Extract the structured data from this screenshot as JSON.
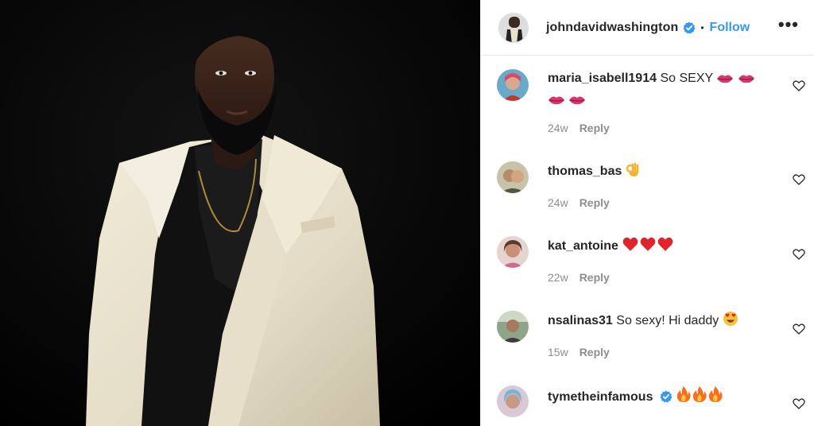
{
  "header": {
    "username": "johndavidwashington",
    "separator": "•",
    "follow_label": "Follow",
    "more_label": "•••"
  },
  "comments": [
    {
      "username": "maria_isabell1914",
      "text": "So SEXY",
      "emoji": [
        "lips",
        "lips",
        "lips",
        "lips"
      ],
      "age": "24w",
      "reply_label": "Reply"
    },
    {
      "username": "thomas_bas",
      "text": "",
      "emoji": [
        "ok-hand"
      ],
      "age": "24w",
      "reply_label": "Reply"
    },
    {
      "username": "kat_antoine",
      "text": "",
      "emoji": [
        "red-heart",
        "red-heart",
        "red-heart"
      ],
      "age": "22w",
      "reply_label": "Reply"
    },
    {
      "username": "nsalinas31",
      "text": "So sexy! Hi daddy",
      "emoji": [
        "heart-eyes"
      ],
      "age": "15w",
      "reply_label": "Reply"
    },
    {
      "username": "tymetheinfamous",
      "text": "",
      "emoji": [
        "fire",
        "fire",
        "fire"
      ],
      "verified": true,
      "age": "",
      "reply_label": ""
    }
  ],
  "colors": {
    "link_blue": "#3897f0",
    "text": "#262626",
    "muted": "#8e8e8e",
    "coat": "#e9e2cf"
  }
}
